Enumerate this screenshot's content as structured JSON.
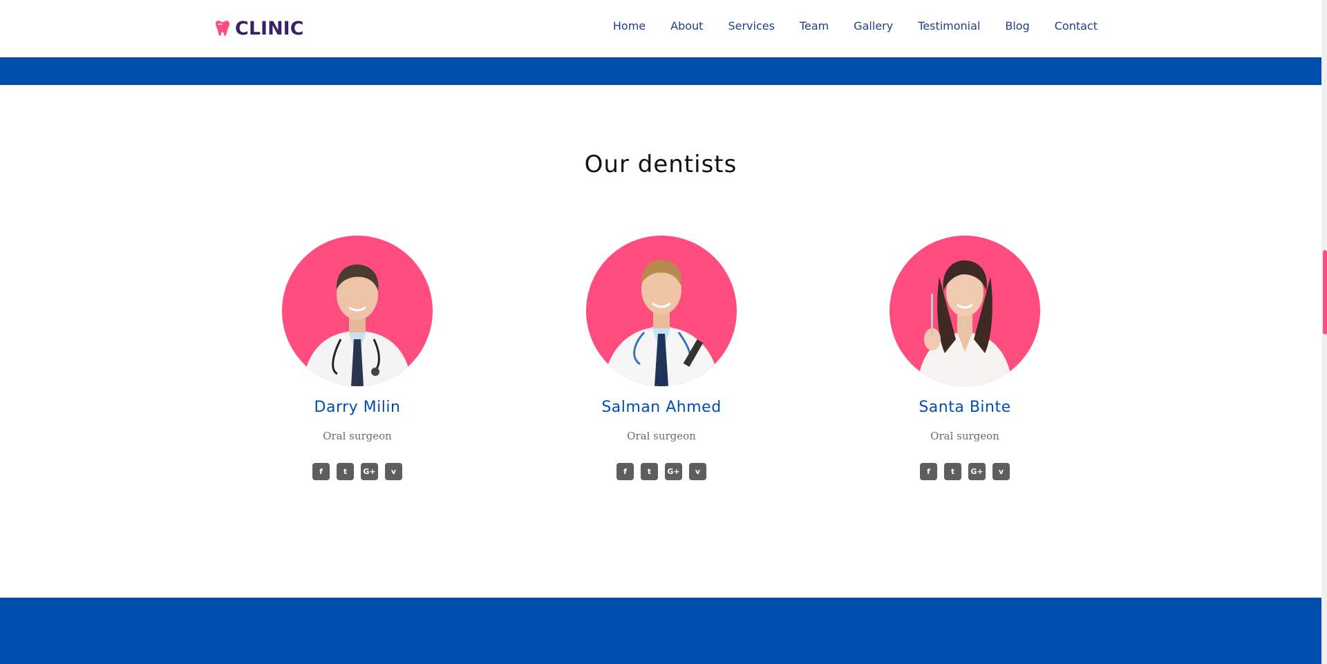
{
  "header": {
    "logo_text": "CLINIC",
    "logo_icon": "tooth-icon",
    "nav": [
      {
        "label": "Home"
      },
      {
        "label": "About"
      },
      {
        "label": "Services"
      },
      {
        "label": "Team"
      },
      {
        "label": "Gallery"
      },
      {
        "label": "Testimonial"
      },
      {
        "label": "Blog"
      },
      {
        "label": "Contact"
      }
    ]
  },
  "colors": {
    "primary_blue": "#004eab",
    "accent_pink": "#ff4d80",
    "nav_text": "#1d3f8a",
    "icon_gray": "#5e5e5e"
  },
  "team_section": {
    "title": "Our dentists",
    "members": [
      {
        "name": "Darry Milin",
        "role": "Oral surgeon",
        "social_icons": [
          "facebook-icon",
          "twitter-icon",
          "google-plus-icon",
          "vimeo-icon"
        ]
      },
      {
        "name": "Salman Ahmed",
        "role": "Oral surgeon",
        "social_icons": [
          "facebook-icon",
          "twitter-icon",
          "google-plus-icon",
          "vimeo-icon"
        ]
      },
      {
        "name": "Santa Binte",
        "role": "Oral surgeon",
        "social_icons": [
          "facebook-icon",
          "twitter-icon",
          "google-plus-icon",
          "vimeo-icon"
        ]
      }
    ]
  }
}
